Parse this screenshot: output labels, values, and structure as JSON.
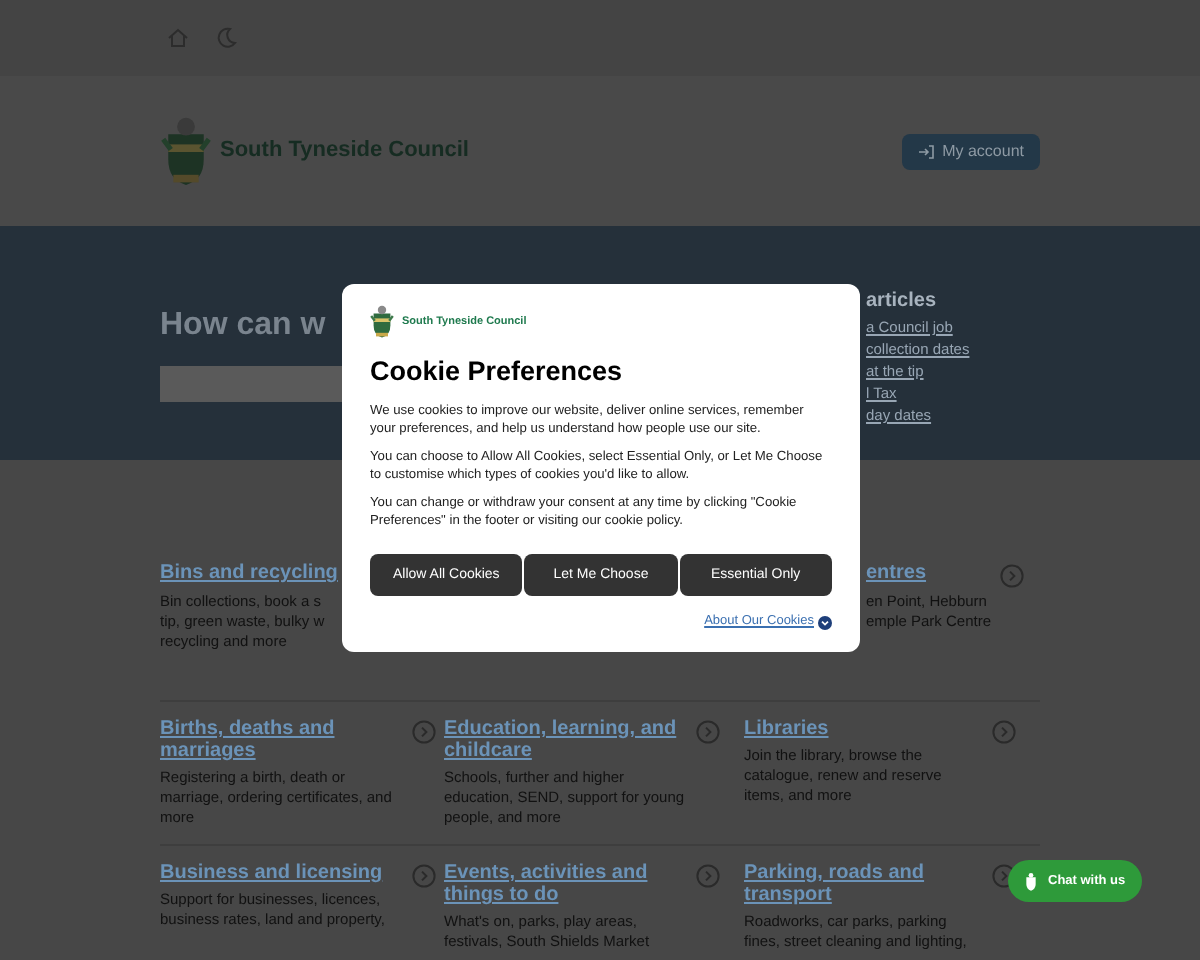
{
  "header": {
    "logo_text": "South Tyneside Council",
    "account_button": "My account"
  },
  "hero": {
    "heading": "How can w",
    "popular_heading": "articles",
    "popular_links": [
      "a Council job",
      "collection dates",
      "at the tip",
      "l Tax",
      "day dates"
    ]
  },
  "service_rows": [
    [
      {
        "kind": "left_visible",
        "title": "Bins and recycling",
        "lines": [
          "Bin collections, book a s",
          "tip, green waste, bulky w",
          "recycling and more"
        ]
      },
      {
        "kind": "hidden"
      },
      {
        "kind": "right_visible",
        "title": "entres",
        "lines": [
          "en Point, Hebburn",
          "emple Park Centre"
        ]
      }
    ],
    [
      {
        "kind": "full",
        "title": "Births, deaths and marriages",
        "description": "Registering a birth, death or marriage, ordering certificates, and more"
      },
      {
        "kind": "full",
        "title": "Education, learning, and childcare",
        "description": "Schools, further and higher education, SEND, support for young people, and more"
      },
      {
        "kind": "full",
        "title": "Libraries",
        "description": "Join the library, browse the catalogue, renew and reserve items, and more"
      }
    ],
    [
      {
        "kind": "full",
        "title": "Business and licensing",
        "description": "Support for businesses, licences, business rates, land and property,"
      },
      {
        "kind": "full",
        "title": "Events, activities and things to do",
        "description": "What's on, parks, play areas, festivals, South Shields Market"
      },
      {
        "kind": "full",
        "title": "Parking, roads and transport",
        "description": "Roadworks, car parks, parking fines, street cleaning and lighting,"
      }
    ]
  ],
  "cookie_dialog": {
    "logo_text": "South Tyneside Council",
    "title": "Cookie Preferences",
    "paragraphs": [
      "We use cookies to improve our website, deliver online services, remember your preferences, and help us understand how people use our site.",
      "You can choose to Allow All Cookies, select Essential Only, or Let Me Choose to customise which types of cookies you'd like to allow.",
      "You can change or withdraw your consent at any time by clicking \"Cookie Preferences\" in the footer or visiting our cookie policy."
    ],
    "buttons": [
      "Allow All Cookies",
      "Let Me Choose",
      "Essential Only"
    ],
    "link": "About Our Cookies"
  },
  "chat_button": "Chat with us"
}
